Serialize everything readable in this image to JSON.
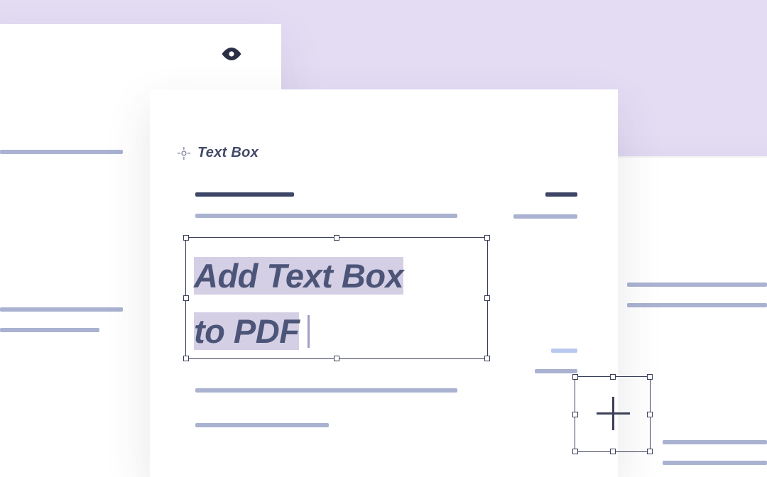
{
  "label": "Text Box",
  "textbox": {
    "line1": "Add Text Box",
    "line2": "to PDF"
  },
  "colors": {
    "text": "#4c5578",
    "highlight": "#d4cfe5",
    "placeholderLine": "#a9b2d0",
    "thickLine": "#3d4667",
    "lavenderBg": "#e4dcf3"
  }
}
